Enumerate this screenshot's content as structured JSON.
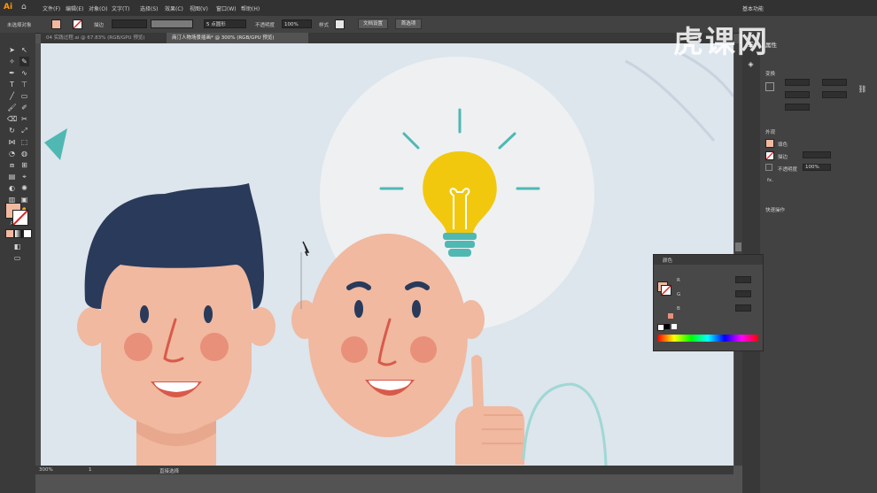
{
  "app": {
    "logo": "Ai",
    "workspace": "基本功能"
  },
  "menu": [
    "文件(F)",
    "编辑(E)",
    "对象(O)",
    "文字(T)",
    "选择(S)",
    "效果(C)",
    "视图(V)",
    "窗口(W)",
    "帮助(H)"
  ],
  "control": {
    "no_selection": "未选择对象",
    "stroke_label": "描边",
    "brush_value": "5 点圆形",
    "opacity_label": "不透明度",
    "opacity_value": "100%",
    "style_label": "样式",
    "doc_setup": "文档设置",
    "prefs": "首选项"
  },
  "tabs": [
    {
      "label": "04 实践过程.ai @ 67.83% (RGB/GPU 预览)",
      "active": false
    },
    {
      "label": "商汀人物场景插画* @ 300% (RGB/GPU 预览)",
      "active": true
    }
  ],
  "status": {
    "zoom": "300%",
    "page": "1",
    "tool": "直接选择"
  },
  "right_panel": {
    "attributes_title": "属性",
    "transform_title": "变换",
    "appearance_title": "外观",
    "fill_label": "填色",
    "stroke_label": "描边",
    "opacity_label": "不透明度",
    "opacity_value": "100%",
    "fx_label": "fx.",
    "quick_actions": "快速操作"
  },
  "color_panel": {
    "title": "颜色",
    "r_label": "R",
    "g_label": "G",
    "b_label": "B"
  },
  "watermark": "虎课网",
  "colors": {
    "hair": "#2a3a5a",
    "skin": "#f0b9a0",
    "cheek": "#e8907a",
    "bulb": "#f2c80f",
    "bulb_base": "#4fb8b3",
    "rays": "#4fb8b3",
    "canvas_bg": "#dde5ed",
    "halo": "#eef0f2"
  }
}
